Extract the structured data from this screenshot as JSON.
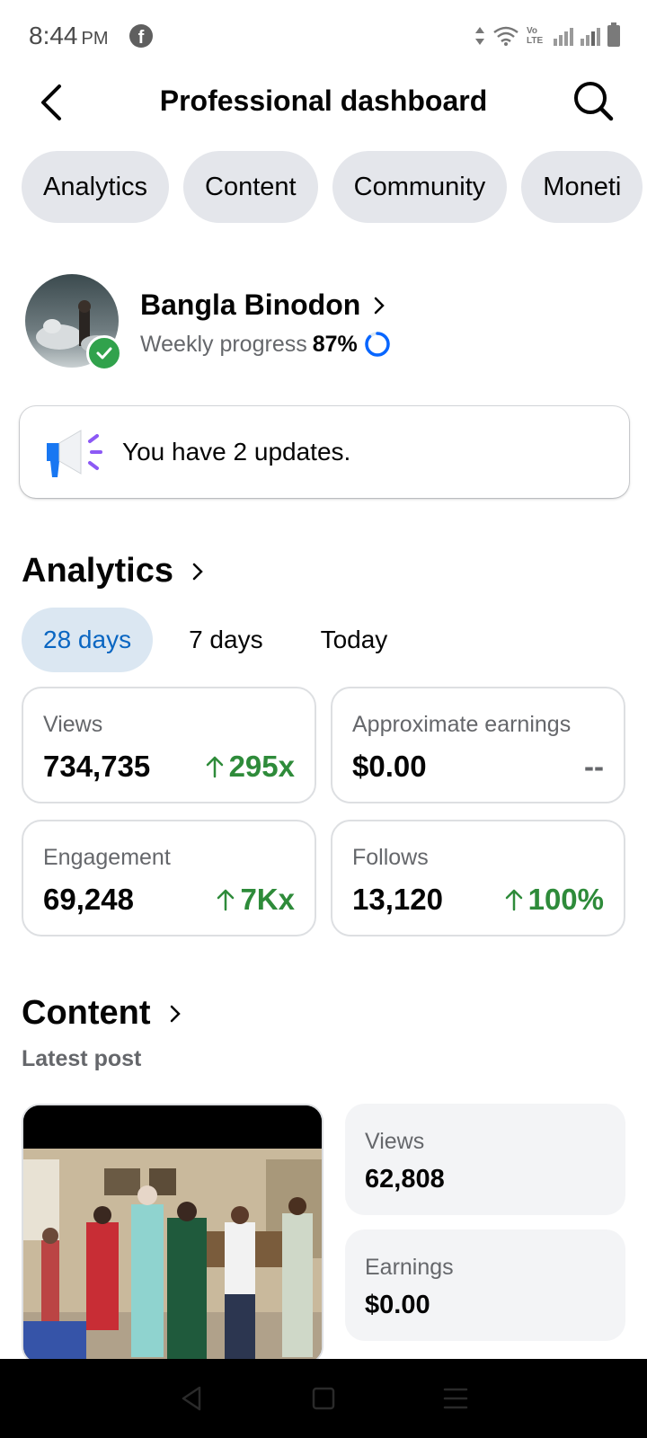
{
  "status_bar": {
    "time": "8:44",
    "ampm": "PM",
    "network_label": "Vo LTE"
  },
  "header": {
    "title": "Professional dashboard"
  },
  "tabs": [
    {
      "label": "Analytics"
    },
    {
      "label": "Content"
    },
    {
      "label": "Community"
    },
    {
      "label": "Moneti"
    }
  ],
  "profile": {
    "name": "Bangla Binodon",
    "progress_label": "Weekly progress",
    "progress_value": "87%",
    "progress_fraction": 0.87
  },
  "updates": {
    "text": "You have 2 updates."
  },
  "analytics": {
    "title": "Analytics",
    "ranges": [
      "28 days",
      "7 days",
      "Today"
    ],
    "selected_range": "28 days",
    "metrics": [
      {
        "label": "Views",
        "value": "734,735",
        "change": "295x",
        "trend": "up"
      },
      {
        "label": "Approximate earnings",
        "value": "$0.00",
        "change": "--",
        "trend": "none"
      },
      {
        "label": "Engagement",
        "value": "69,248",
        "change": "7Kx",
        "trend": "up"
      },
      {
        "label": "Follows",
        "value": "13,120",
        "change": "100%",
        "trend": "up"
      }
    ]
  },
  "content": {
    "title": "Content",
    "latest_post_label": "Latest post",
    "stats": [
      {
        "label": "Views",
        "value": "62,808"
      },
      {
        "label": "Earnings",
        "value": "$0.00"
      }
    ]
  },
  "colors": {
    "accent_blue": "#0a66c2",
    "positive_green": "#2e8b3a",
    "pill_bg": "#e4e6eb",
    "selected_range_bg": "#dbe7f2"
  }
}
